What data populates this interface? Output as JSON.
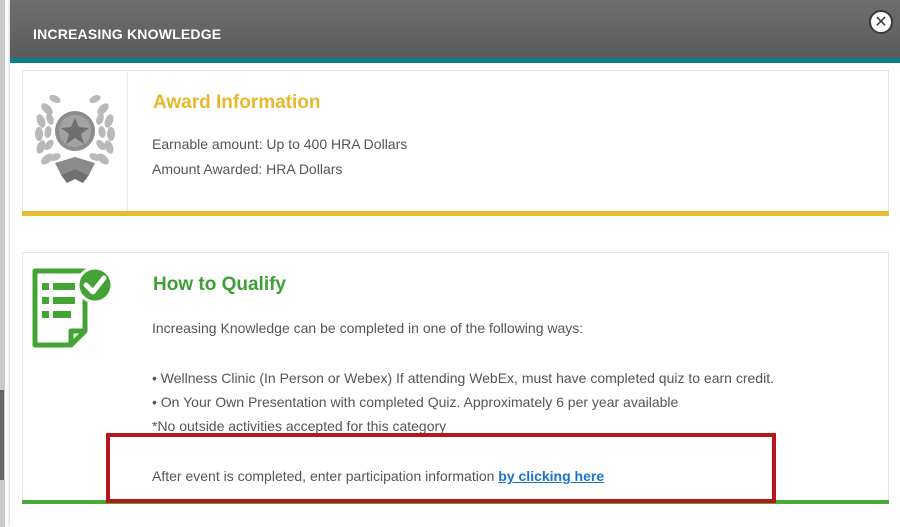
{
  "modal": {
    "title": "INCREASING KNOWLEDGE",
    "close_icon": "close-icon",
    "header_color": "#606060",
    "accent_color": "#0b7f8a"
  },
  "award": {
    "title": "Award Information",
    "icon": "award-laurel-star-icon",
    "title_color": "#e8b82c",
    "earnable": "Earnable amount: Up to 400 HRA Dollars",
    "awarded": "Amount Awarded: HRA Dollars"
  },
  "qualify": {
    "title": "How to Qualify",
    "icon": "checklist-check-icon",
    "title_color": "#3f9f35",
    "intro": "Increasing Knowledge can be completed in one of the following ways:",
    "items": [
      "• Wellness Clinic (In Person or Webex) If attending WebEx, must have completed quiz to earn credit.",
      "• On Your Own Presentation with completed Quiz. Approximately 6 per year available"
    ],
    "note": "*No outside activities accepted for this category",
    "after_text": "After event is completed, enter participation information ",
    "link_text": "by clicking here"
  },
  "highlight_color": "#b5171c"
}
